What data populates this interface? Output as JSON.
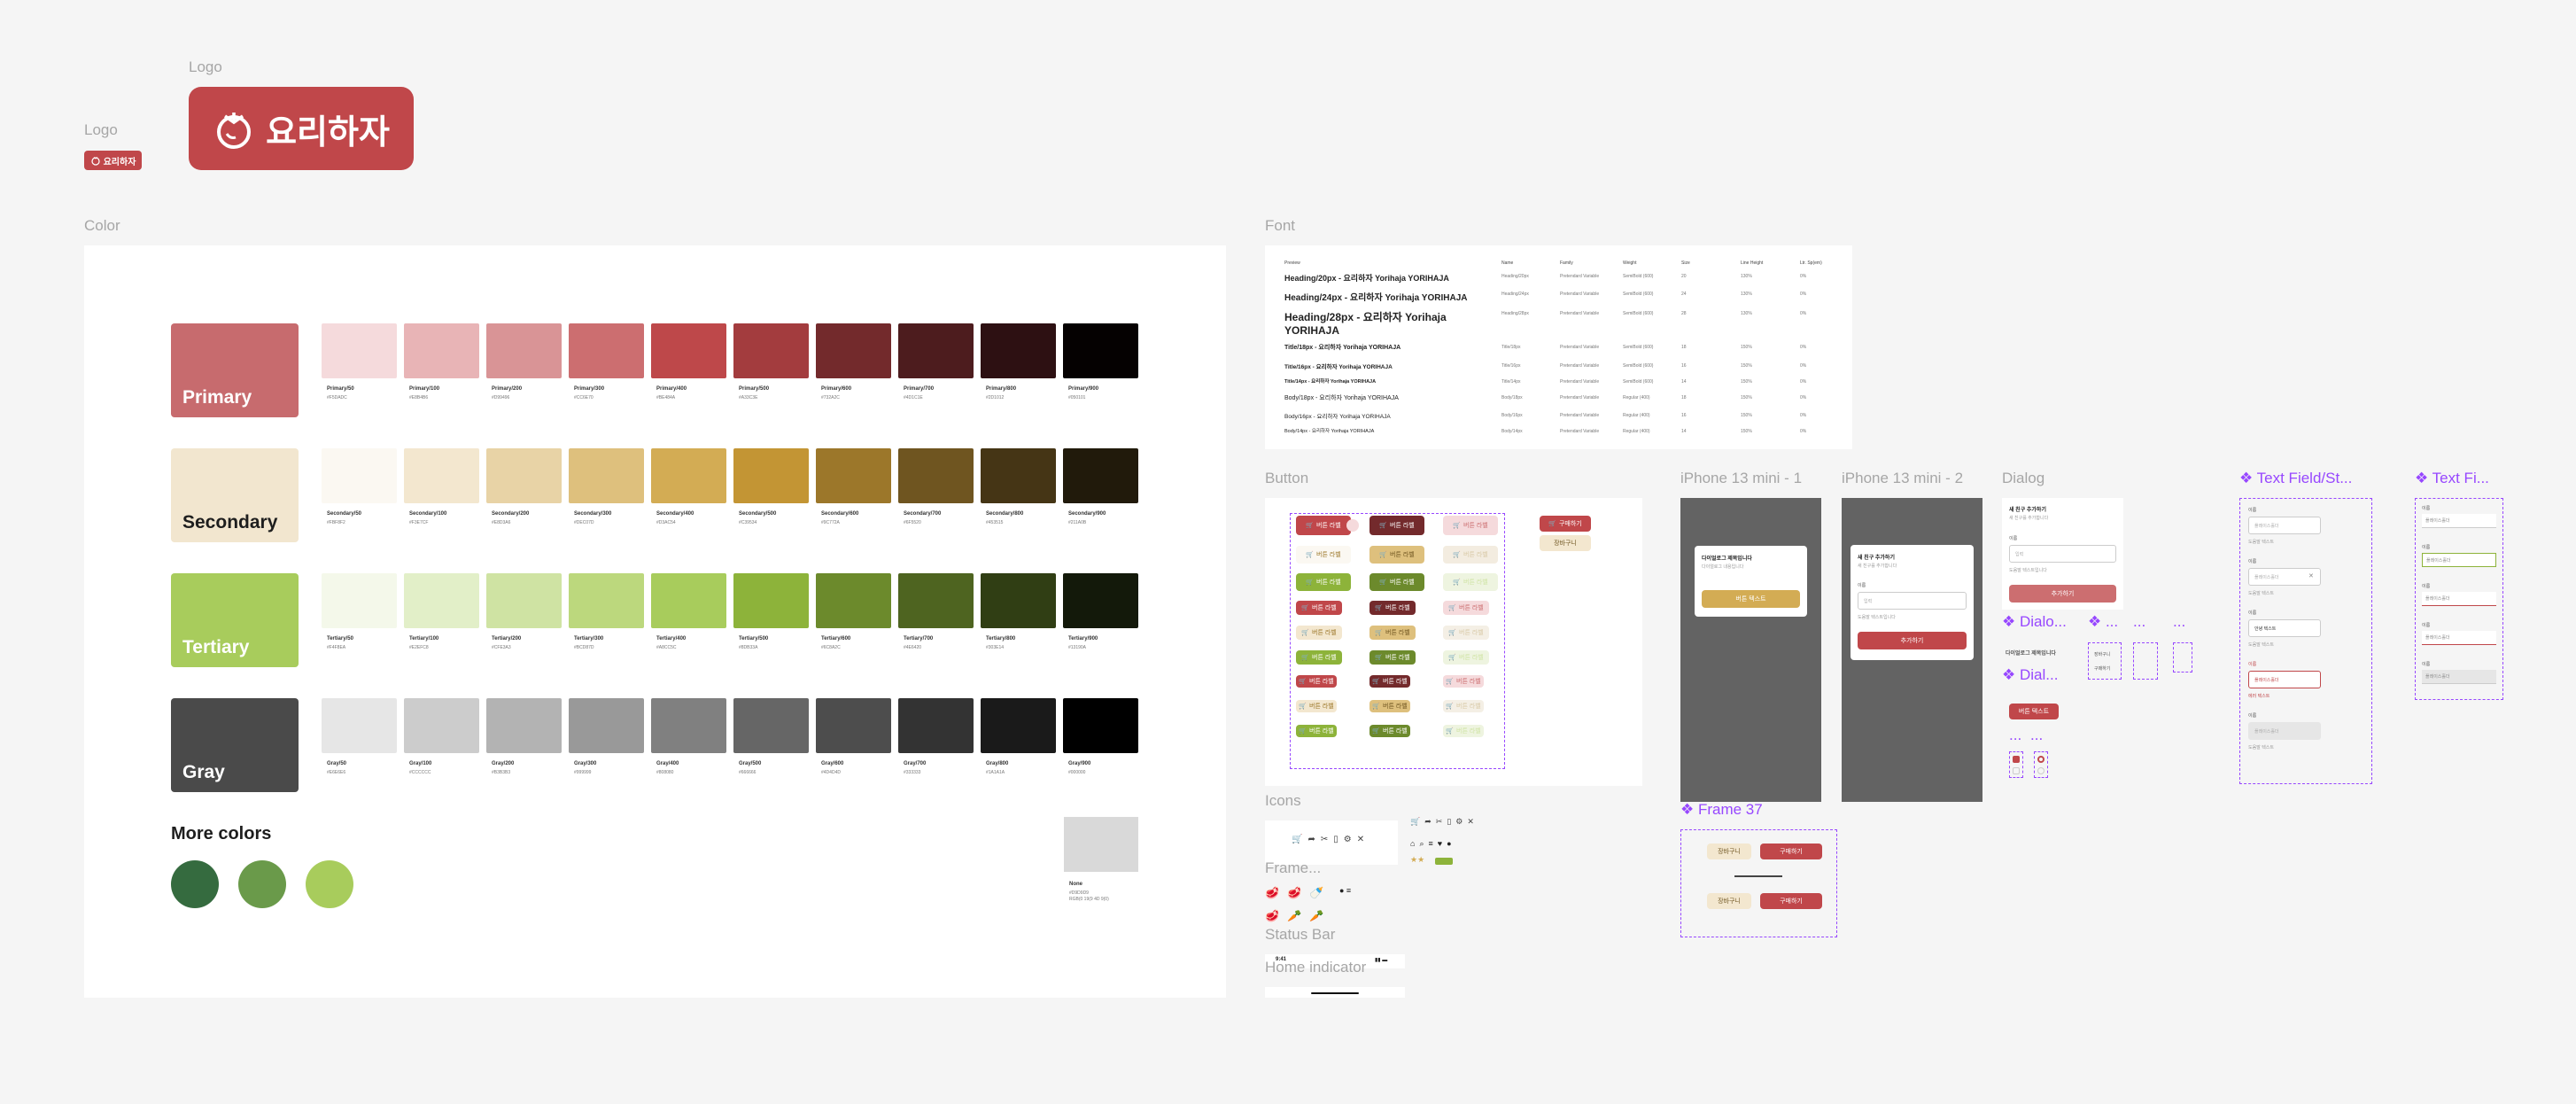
{
  "labels": {
    "logo": "Logo",
    "color": "Color",
    "font": "Font",
    "button": "Button",
    "icons": "Icons",
    "frame": "Frame...",
    "status_bar": "Status Bar",
    "home_indicator": "Home indicator",
    "iphone1": "iPhone 13 mini - 1",
    "iphone2": "iPhone 13 mini - 2",
    "dialog": "Dialog",
    "text_field_1": "❖ Text Field/St...",
    "text_field_2": "❖ Text Fi...",
    "dialo_1": "❖ Dialo...",
    "dialo_2": "❖ Dial...",
    "frame37": "❖ Frame 37",
    "dots": "❖ ...",
    "ellipsis": "..."
  },
  "logo": {
    "text": "요리하자"
  },
  "palettes": [
    {
      "name": "Primary",
      "main": "#c76b6e",
      "text_color": "#ffffff",
      "prefix": "Primary",
      "swatches": [
        {
          "step": "50",
          "hex": "#F5DADC"
        },
        {
          "step": "100",
          "hex": "#E8B4B6"
        },
        {
          "step": "200",
          "hex": "#D99496"
        },
        {
          "step": "300",
          "hex": "#CC6E70"
        },
        {
          "step": "400",
          "hex": "#BE484A"
        },
        {
          "step": "500",
          "hex": "#A33C3E"
        },
        {
          "step": "600",
          "hex": "#732A2C"
        },
        {
          "step": "700",
          "hex": "#4D1C1E"
        },
        {
          "step": "800",
          "hex": "#2D1012"
        },
        {
          "step": "900",
          "hex": "#050101"
        }
      ]
    },
    {
      "name": "Secondary",
      "main": "#f2e6cf",
      "text_color": "#1e1e1e",
      "prefix": "Secondary",
      "swatches": [
        {
          "step": "50",
          "hex": "#FBF8F2"
        },
        {
          "step": "100",
          "hex": "#F3E7CF"
        },
        {
          "step": "200",
          "hex": "#E8D3A6"
        },
        {
          "step": "300",
          "hex": "#DEC07D"
        },
        {
          "step": "400",
          "hex": "#D3AC54"
        },
        {
          "step": "500",
          "hex": "#C39534"
        },
        {
          "step": "600",
          "hex": "#9C772A"
        },
        {
          "step": "700",
          "hex": "#6F5520"
        },
        {
          "step": "800",
          "hex": "#453515"
        },
        {
          "step": "900",
          "hex": "#211A0B"
        }
      ]
    },
    {
      "name": "Tertiary",
      "main": "#a8cc5c",
      "text_color": "#ffffff",
      "prefix": "Tertiary",
      "swatches": [
        {
          "step": "50",
          "hex": "#F4F8EA"
        },
        {
          "step": "100",
          "hex": "#E2EFC8"
        },
        {
          "step": "200",
          "hex": "#CFE3A3"
        },
        {
          "step": "300",
          "hex": "#BCD87D"
        },
        {
          "step": "400",
          "hex": "#A8CC5C"
        },
        {
          "step": "500",
          "hex": "#8DB33A"
        },
        {
          "step": "600",
          "hex": "#6C8A2C"
        },
        {
          "step": "700",
          "hex": "#4E6420"
        },
        {
          "step": "800",
          "hex": "#303E14"
        },
        {
          "step": "900",
          "hex": "#13190A"
        }
      ]
    },
    {
      "name": "Gray",
      "main": "#4a4a4a",
      "text_color": "#ffffff",
      "prefix": "Gray",
      "swatches": [
        {
          "step": "50",
          "hex": "#E6E6E6"
        },
        {
          "step": "100",
          "hex": "#CCCCCC"
        },
        {
          "step": "200",
          "hex": "#B3B3B3"
        },
        {
          "step": "300",
          "hex": "#999999"
        },
        {
          "step": "400",
          "hex": "#808080"
        },
        {
          "step": "500",
          "hex": "#666666"
        },
        {
          "step": "600",
          "hex": "#4D4D4D"
        },
        {
          "step": "700",
          "hex": "#333333"
        },
        {
          "step": "800",
          "hex": "#1A1A1A"
        },
        {
          "step": "900",
          "hex": "#000000"
        }
      ]
    }
  ],
  "more_colors": {
    "title": "More colors",
    "circles": [
      "#356b3f",
      "#6a9a4a",
      "#a8cc5c"
    ],
    "extra": {
      "hex": "#D9D9D9",
      "name": "None",
      "value": "#D9D9D9",
      "rgb": "RGB(0 19(9 4D 9(0)"
    }
  },
  "font_table": {
    "headers": [
      "Preview",
      "Name",
      "Family",
      "Weight",
      "Size",
      "Line Height",
      "Ltr. Sp(em)"
    ],
    "rows": [
      {
        "preview": "Heading/20px - 요리하자 Yorihaja YORIHAJA",
        "name": "Heading/20px",
        "family": "Pretendard Variable",
        "weight": "SemiBold (600)",
        "size": "20",
        "lh": "130%",
        "ls": "0%"
      },
      {
        "preview": "Heading/24px - 요리하자 Yorihaja YORIHAJA",
        "name": "Heading/24px",
        "family": "Pretendard Variable",
        "weight": "SemiBold (600)",
        "size": "24",
        "lh": "130%",
        "ls": "0%"
      },
      {
        "preview": "Heading/28px - 요리하자 Yorihaja YORIHAJA",
        "name": "Heading/28px",
        "family": "Pretendard Variable",
        "weight": "SemiBold (600)",
        "size": "28",
        "lh": "130%",
        "ls": "0%"
      },
      {
        "preview": "Title/18px - 요리하자 Yorihaja YORIHAJA",
        "name": "Title/18px",
        "family": "Pretendard Variable",
        "weight": "SemiBold (600)",
        "size": "18",
        "lh": "150%",
        "ls": "0%"
      },
      {
        "preview": "Title/16px - 요리하자 Yorihaja YORIHAJA",
        "name": "Title/16px",
        "family": "Pretendard Variable",
        "weight": "SemiBold (600)",
        "size": "16",
        "lh": "150%",
        "ls": "0%"
      },
      {
        "preview": "Title/14px - 요리하자 Yorihaja YORIHAJA",
        "name": "Title/14px",
        "family": "Pretendard Variable",
        "weight": "SemiBold (600)",
        "size": "14",
        "lh": "150%",
        "ls": "0%"
      },
      {
        "preview": "Body/18px - 요리하자 Yorihaja YORIHAJA",
        "name": "Body/18px",
        "family": "Pretendard Variable",
        "weight": "Regular (400)",
        "size": "18",
        "lh": "150%",
        "ls": "0%"
      },
      {
        "preview": "Body/16px - 요리하자 Yorihaja YORIHAJA",
        "name": "Body/16px",
        "family": "Pretendard Variable",
        "weight": "Regular (400)",
        "size": "16",
        "lh": "150%",
        "ls": "0%"
      },
      {
        "preview": "Body/14px - 요리하자 Yorihaja YORIHAJA",
        "name": "Body/14px",
        "family": "Pretendard Variable",
        "weight": "Regular (400)",
        "size": "14",
        "lh": "150%",
        "ls": "0%"
      }
    ]
  },
  "buttons": {
    "label": "버튼 라벨",
    "buy": "구매하기",
    "cart": "장바구니",
    "add": "추가하기"
  },
  "dialogs": {
    "phone_dialog_title": "다이얼로그 제목입니다",
    "phone_dialog_body": "다이얼로그 내용입니다",
    "phone_dialog_btn": "버튼 텍스트",
    "friend_title": "새 친구 추가하기",
    "friend_body": "새 친구를 추가합니다",
    "name_label": "이름",
    "name_placeholder": "입력",
    "helper": "도움말 텍스트입니다",
    "add_btn": "추가하기",
    "dlg_title": "다이얼로그 제목입니다",
    "dlg_btn": "버튼 텍스트",
    "cart_btn": "장바구니",
    "buy_btn": "구매하기"
  },
  "text_fields": {
    "label": "이름",
    "placeholder": "플레이스홀더",
    "helper": "도움말 텍스트",
    "value": "안녕 텍스트",
    "error": "에러 텍스트"
  },
  "status_bar_time": "9:41"
}
